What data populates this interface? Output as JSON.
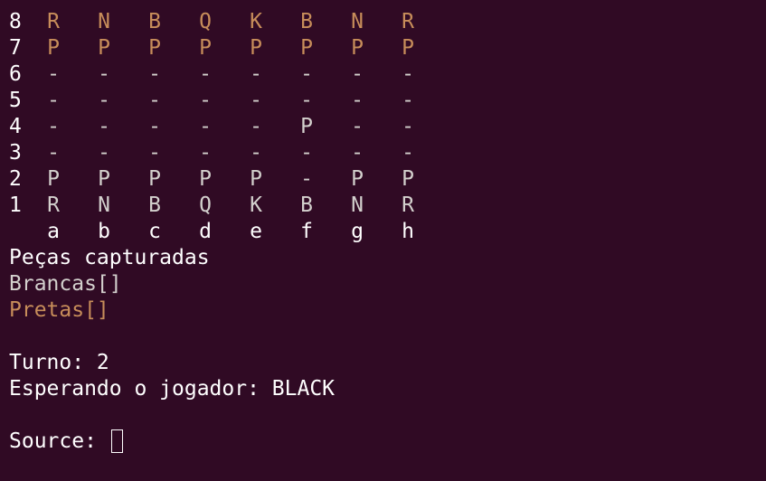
{
  "board": {
    "ranks": [
      {
        "label": "8",
        "cells": [
          {
            "t": "R",
            "c": "black"
          },
          {
            "t": "N",
            "c": "black"
          },
          {
            "t": "B",
            "c": "black"
          },
          {
            "t": "Q",
            "c": "black"
          },
          {
            "t": "K",
            "c": "black"
          },
          {
            "t": "B",
            "c": "black"
          },
          {
            "t": "N",
            "c": "black"
          },
          {
            "t": "R",
            "c": "black"
          }
        ]
      },
      {
        "label": "7",
        "cells": [
          {
            "t": "P",
            "c": "black"
          },
          {
            "t": "P",
            "c": "black"
          },
          {
            "t": "P",
            "c": "black"
          },
          {
            "t": "P",
            "c": "black"
          },
          {
            "t": "P",
            "c": "black"
          },
          {
            "t": "P",
            "c": "black"
          },
          {
            "t": "P",
            "c": "black"
          },
          {
            "t": "P",
            "c": "black"
          }
        ]
      },
      {
        "label": "6",
        "cells": [
          {
            "t": "-",
            "c": "empty"
          },
          {
            "t": "-",
            "c": "empty"
          },
          {
            "t": "-",
            "c": "empty"
          },
          {
            "t": "-",
            "c": "empty"
          },
          {
            "t": "-",
            "c": "empty"
          },
          {
            "t": "-",
            "c": "empty"
          },
          {
            "t": "-",
            "c": "empty"
          },
          {
            "t": "-",
            "c": "empty"
          }
        ]
      },
      {
        "label": "5",
        "cells": [
          {
            "t": "-",
            "c": "empty"
          },
          {
            "t": "-",
            "c": "empty"
          },
          {
            "t": "-",
            "c": "empty"
          },
          {
            "t": "-",
            "c": "empty"
          },
          {
            "t": "-",
            "c": "empty"
          },
          {
            "t": "-",
            "c": "empty"
          },
          {
            "t": "-",
            "c": "empty"
          },
          {
            "t": "-",
            "c": "empty"
          }
        ]
      },
      {
        "label": "4",
        "cells": [
          {
            "t": "-",
            "c": "empty"
          },
          {
            "t": "-",
            "c": "empty"
          },
          {
            "t": "-",
            "c": "empty"
          },
          {
            "t": "-",
            "c": "empty"
          },
          {
            "t": "-",
            "c": "empty"
          },
          {
            "t": "P",
            "c": "white"
          },
          {
            "t": "-",
            "c": "empty"
          },
          {
            "t": "-",
            "c": "empty"
          }
        ]
      },
      {
        "label": "3",
        "cells": [
          {
            "t": "-",
            "c": "empty"
          },
          {
            "t": "-",
            "c": "empty"
          },
          {
            "t": "-",
            "c": "empty"
          },
          {
            "t": "-",
            "c": "empty"
          },
          {
            "t": "-",
            "c": "empty"
          },
          {
            "t": "-",
            "c": "empty"
          },
          {
            "t": "-",
            "c": "empty"
          },
          {
            "t": "-",
            "c": "empty"
          }
        ]
      },
      {
        "label": "2",
        "cells": [
          {
            "t": "P",
            "c": "white"
          },
          {
            "t": "P",
            "c": "white"
          },
          {
            "t": "P",
            "c": "white"
          },
          {
            "t": "P",
            "c": "white"
          },
          {
            "t": "P",
            "c": "white"
          },
          {
            "t": "-",
            "c": "empty"
          },
          {
            "t": "P",
            "c": "white"
          },
          {
            "t": "P",
            "c": "white"
          }
        ]
      },
      {
        "label": "1",
        "cells": [
          {
            "t": "R",
            "c": "white"
          },
          {
            "t": "N",
            "c": "white"
          },
          {
            "t": "B",
            "c": "white"
          },
          {
            "t": "Q",
            "c": "white"
          },
          {
            "t": "K",
            "c": "white"
          },
          {
            "t": "B",
            "c": "white"
          },
          {
            "t": "N",
            "c": "white"
          },
          {
            "t": "R",
            "c": "white"
          }
        ]
      }
    ],
    "files": [
      "a",
      "b",
      "c",
      "d",
      "e",
      "f",
      "g",
      "h"
    ]
  },
  "captured": {
    "heading": "Peças capturadas",
    "white_label": "Brancas[]",
    "black_label": "Pretas[]"
  },
  "status": {
    "turn_text": "Turno: 2",
    "waiting_text": "Esperando o jogador: BLACK"
  },
  "prompt": {
    "label": "Source: "
  },
  "colors": {
    "background": "#300a24",
    "foreground": "#ffffff",
    "white_pieces": "#d3d0cd",
    "black_pieces": "#c78d5a"
  }
}
